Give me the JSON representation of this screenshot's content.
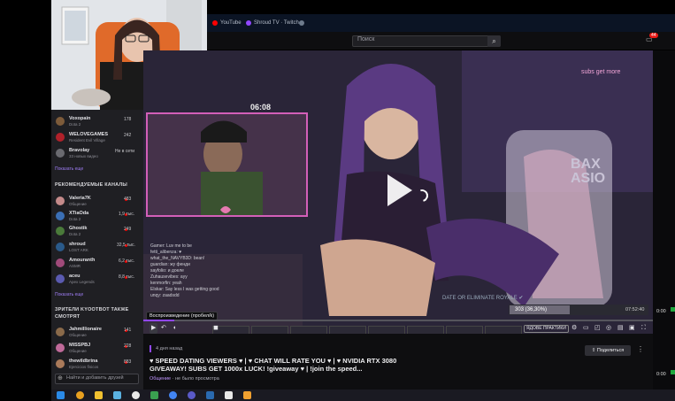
{
  "browser_tabs": [
    {
      "label": "YouTube",
      "color": "#ff0000"
    },
    {
      "label": "Shroud TV · Twitch",
      "color": "#9147ff"
    },
    {
      "label": "",
      "color": "#6e7b8c"
    }
  ],
  "topbar": {
    "search_placeholder": "Поиск",
    "notif_count": "44"
  },
  "sidebar": {
    "followed": [
      {
        "name": "Voxopain",
        "game": "Dota 2",
        "count": "178",
        "avatar": "#7d5b3a"
      },
      {
        "name": "WELOVEGAMES",
        "game": "Resident Evil Village",
        "count": "242",
        "avatar": "#b0212a"
      },
      {
        "name": "Bravolay",
        "game": "33 новых видео",
        "count": "Не в сети",
        "avatar": "#6a6a70"
      }
    ],
    "show_more_1": "Показать еще",
    "recommended_header": "РЕКОМЕНДУЕМЫЕ КАНАЛЫ",
    "recommended": [
      {
        "name": "Valeria7K",
        "game": "Общение",
        "count": "483",
        "avatar": "#c48a8a"
      },
      {
        "name": "XTiaOda",
        "game": "Dota 2",
        "count": "1,9 тыс.",
        "avatar": "#3b6fb5"
      },
      {
        "name": "Ghostik",
        "game": "Dota 2",
        "count": "249",
        "avatar": "#4a7a3a"
      },
      {
        "name": "shroud",
        "game": "LOST ARK",
        "count": "32,5 тыс.",
        "avatar": "#2a5a8a"
      },
      {
        "name": "Amouranth",
        "game": "ASMR",
        "count": "6,2 тыс.",
        "avatar": "#a04a7a"
      },
      {
        "name": "aceu",
        "game": "Apex Legends",
        "count": "8,8 тыс.",
        "avatar": "#5a5ab0"
      }
    ],
    "show_more_2": "Показать еще",
    "also_watch_header_1": "ЗРИТЕЛИ KYOOTBOT ТАКЖЕ",
    "also_watch_header_2": "СМОТРЯТ",
    "also_watch": [
      {
        "name": "Jahmillionaire",
        "game": "Общение",
        "count": "141",
        "avatar": "#8a6a4a"
      },
      {
        "name": "MISSPBJ",
        "game": "Общение",
        "count": "228",
        "avatar": "#c06a9a"
      },
      {
        "name": "thewildbrina",
        "game": "Ejercicios físicos",
        "count": "883",
        "avatar": "#aa7a5a"
      }
    ],
    "friends_search": "Найти и добавить друзей"
  },
  "player": {
    "pip_time": "06:08",
    "overlay_title": "subs get more",
    "side_text": "BAX\nASIO",
    "chat_lines": [
      "Gamer: Luv me to be",
      "fetti_alibenza: ♥",
      "what_the_NAVYB3D: bean!",
      "guardian: жу фенди",
      "sayfolio: и доеле",
      "Zuhausevibes: ayy",
      "kenmorfin: yeah",
      "Elskar: Say less I was getting good",
      "unqy: zaadsdd"
    ],
    "prediction_title": "DATE OR ELIMINATE ROYALE ✔",
    "prediction_left": "303 (36,30%)",
    "prediction_right": "07:52:40",
    "tooltip": "Воспроизведение (пробел/k)",
    "live_badge": "ЯДОВЕ ПРАКТИКИ",
    "progress_fraction": 0.06
  },
  "video": {
    "ago": "4 дня назад",
    "title": "♥ SPEED DATING VIEWERS ♥ | ♥ CHAT WILL RATE YOU ♥ | ♥ NVIDIA RTX 3080 GIVEAWAY! SUBS GET 1000x LUCK! !giveaway ♥ | !join the speed...",
    "category": "Общение",
    "meta_suffix": "· не было просмотра",
    "share": "Поделиться"
  },
  "rightcol": [
    "0:00",
    "0:00"
  ],
  "taskbar_icons": [
    "#2a8ae8",
    "#e8a020",
    "#f0c030",
    "#5ab0e0",
    "#e8e8e8",
    "#3aa050",
    "#4285f4",
    "#5a5ac8",
    "#2a6ab0",
    "#e8e8e8",
    "#f0a030"
  ]
}
